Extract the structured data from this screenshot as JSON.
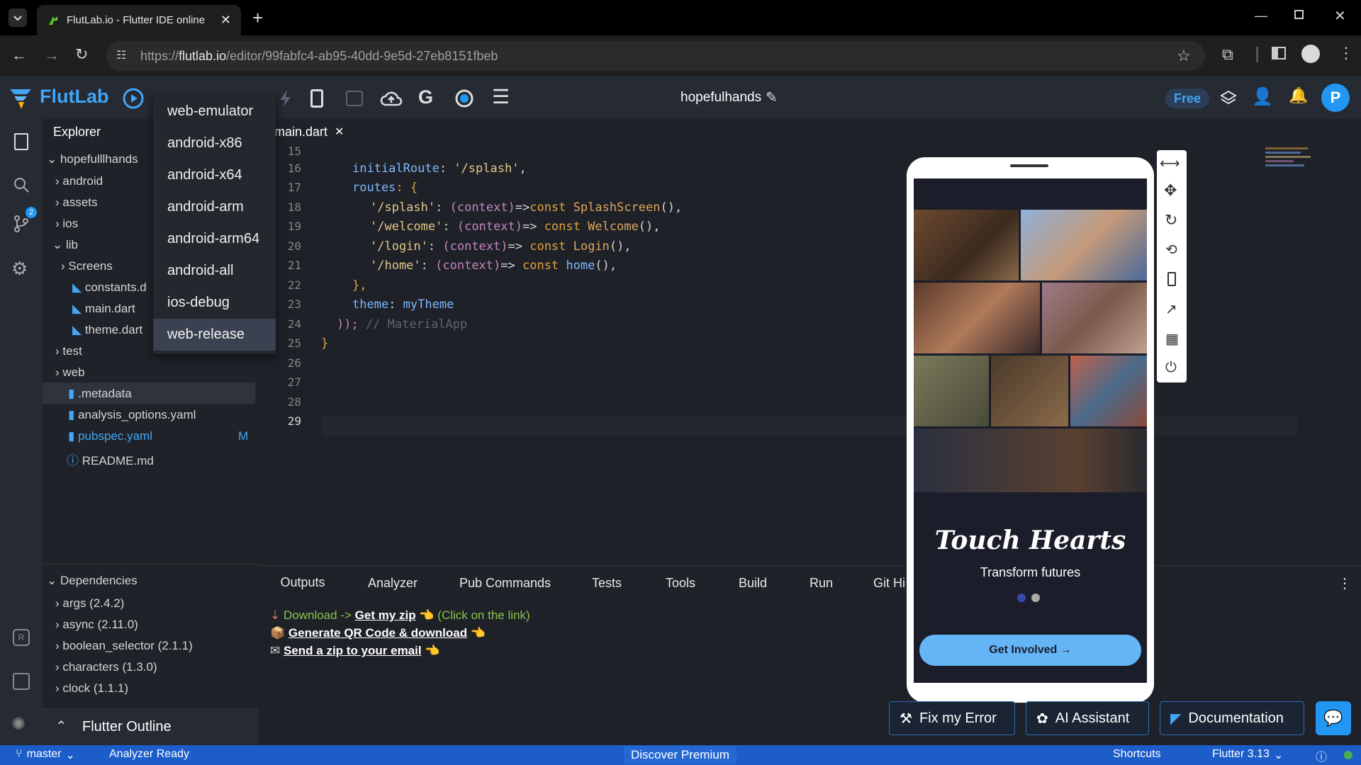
{
  "browser": {
    "tab_title": "FlutLab.io - Flutter IDE online",
    "url_prefix": "https://",
    "url_host": "flutlab.io",
    "url_path": "/editor/99fabfc4-ab95-40dd-9e5d-27eb8151fbeb"
  },
  "app": {
    "brand": "FlutLab",
    "project_name": "hopefulhands",
    "plan_badge": "Free",
    "avatar_letter": "P"
  },
  "explorer": {
    "title": "Explorer",
    "root": "hopefulllhands",
    "items": [
      {
        "label": "android",
        "type": "folder"
      },
      {
        "label": "assets",
        "type": "folder"
      },
      {
        "label": "ios",
        "type": "folder"
      },
      {
        "label": "lib",
        "type": "folder-open"
      },
      {
        "label": "Screens",
        "type": "folder"
      },
      {
        "label": "constants.d",
        "type": "dart"
      },
      {
        "label": "main.dart",
        "type": "dart"
      },
      {
        "label": "theme.dart",
        "type": "dart"
      },
      {
        "label": "test",
        "type": "folder"
      },
      {
        "label": "web",
        "type": "folder"
      },
      {
        "label": ".metadata",
        "type": "file"
      },
      {
        "label": "analysis_options.yaml",
        "type": "file"
      },
      {
        "label": "pubspec.yaml",
        "type": "file"
      },
      {
        "label": "README.md",
        "type": "info"
      }
    ],
    "modified_badge": "M",
    "dependencies_title": "Dependencies",
    "dependencies": [
      "args (2.4.2)",
      "async (2.11.0)",
      "boolean_selector (2.1.1)",
      "characters (1.3.0)",
      "clock (1.1.1)"
    ],
    "outline_title": "Flutter Outline"
  },
  "activity": {
    "scm_badge": "2"
  },
  "build_menu": {
    "items": [
      "web-emulator",
      "android-x86",
      "android-x64",
      "android-arm",
      "android-arm64",
      "android-all",
      "ios-debug",
      "web-release"
    ],
    "selected": "web-release"
  },
  "editor": {
    "tab": "main.dart",
    "line_numbers": [
      "15",
      "16",
      "17",
      "18",
      "19",
      "20",
      "21",
      "22",
      "23",
      "24",
      "25",
      "26",
      "27",
      "28",
      "29"
    ],
    "lines": {
      "l16a": "initialRoute",
      "l16b": ": ",
      "l16c": "'/splash'",
      "l16d": ",",
      "l17a": "routes",
      "l17b": ": {",
      "l18a": "'/splash'",
      "l18b": ": ",
      "l18c": "(context)",
      "l18d": "=>",
      "l18e": "const ",
      "l18f": "SplashScreen",
      "l18g": "(),",
      "l19a": "'/welcome'",
      "l19b": ": ",
      "l19c": "(context)",
      "l19d": "=> ",
      "l19e": "const ",
      "l19f": "Welcome",
      "l19g": "(),",
      "l20a": "'/login'",
      "l20b": ": ",
      "l20c": "(context)",
      "l20d": "=> ",
      "l20e": "const ",
      "l20f": "Login",
      "l20g": "(),",
      "l21a": "'/home'",
      "l21b": ": ",
      "l21c": "(context)",
      "l21d": "=> ",
      "l21e": "const ",
      "l21f": "home",
      "l21g": "(),",
      "l22": "},",
      "l23a": "theme",
      "l23b": ": ",
      "l23c": "myTheme",
      "l24a": "));",
      "l24b": " // MaterialApp",
      "l25": "}"
    }
  },
  "panel": {
    "tabs": [
      "Outputs",
      "Analyzer",
      "Pub Commands",
      "Tests",
      "Tools",
      "Build",
      "Run",
      "Git Hi"
    ],
    "output_line1_prefix": "Download ->",
    "output_line1_link": "Get my zip",
    "output_line1_suffix": "(Click on the link)",
    "output_line2_link": "Generate QR Code & download",
    "output_line3_link": "Send a zip to your email"
  },
  "preview": {
    "headline": "Touch Hearts",
    "subtitle": "Transform futures",
    "cta": "Get Involved →"
  },
  "help_buttons": {
    "fix": "Fix my Error",
    "ai": "AI Assistant",
    "docs": "Documentation"
  },
  "status": {
    "branch": "master",
    "analyzer": "Analyzer Ready",
    "premium": "Discover Premium",
    "shortcuts": "Shortcuts",
    "flutter": "Flutter 3.13"
  },
  "colors": {
    "accent": "#1c5dc9",
    "brand": "#42a5f5",
    "cta": "#64b5f6"
  }
}
